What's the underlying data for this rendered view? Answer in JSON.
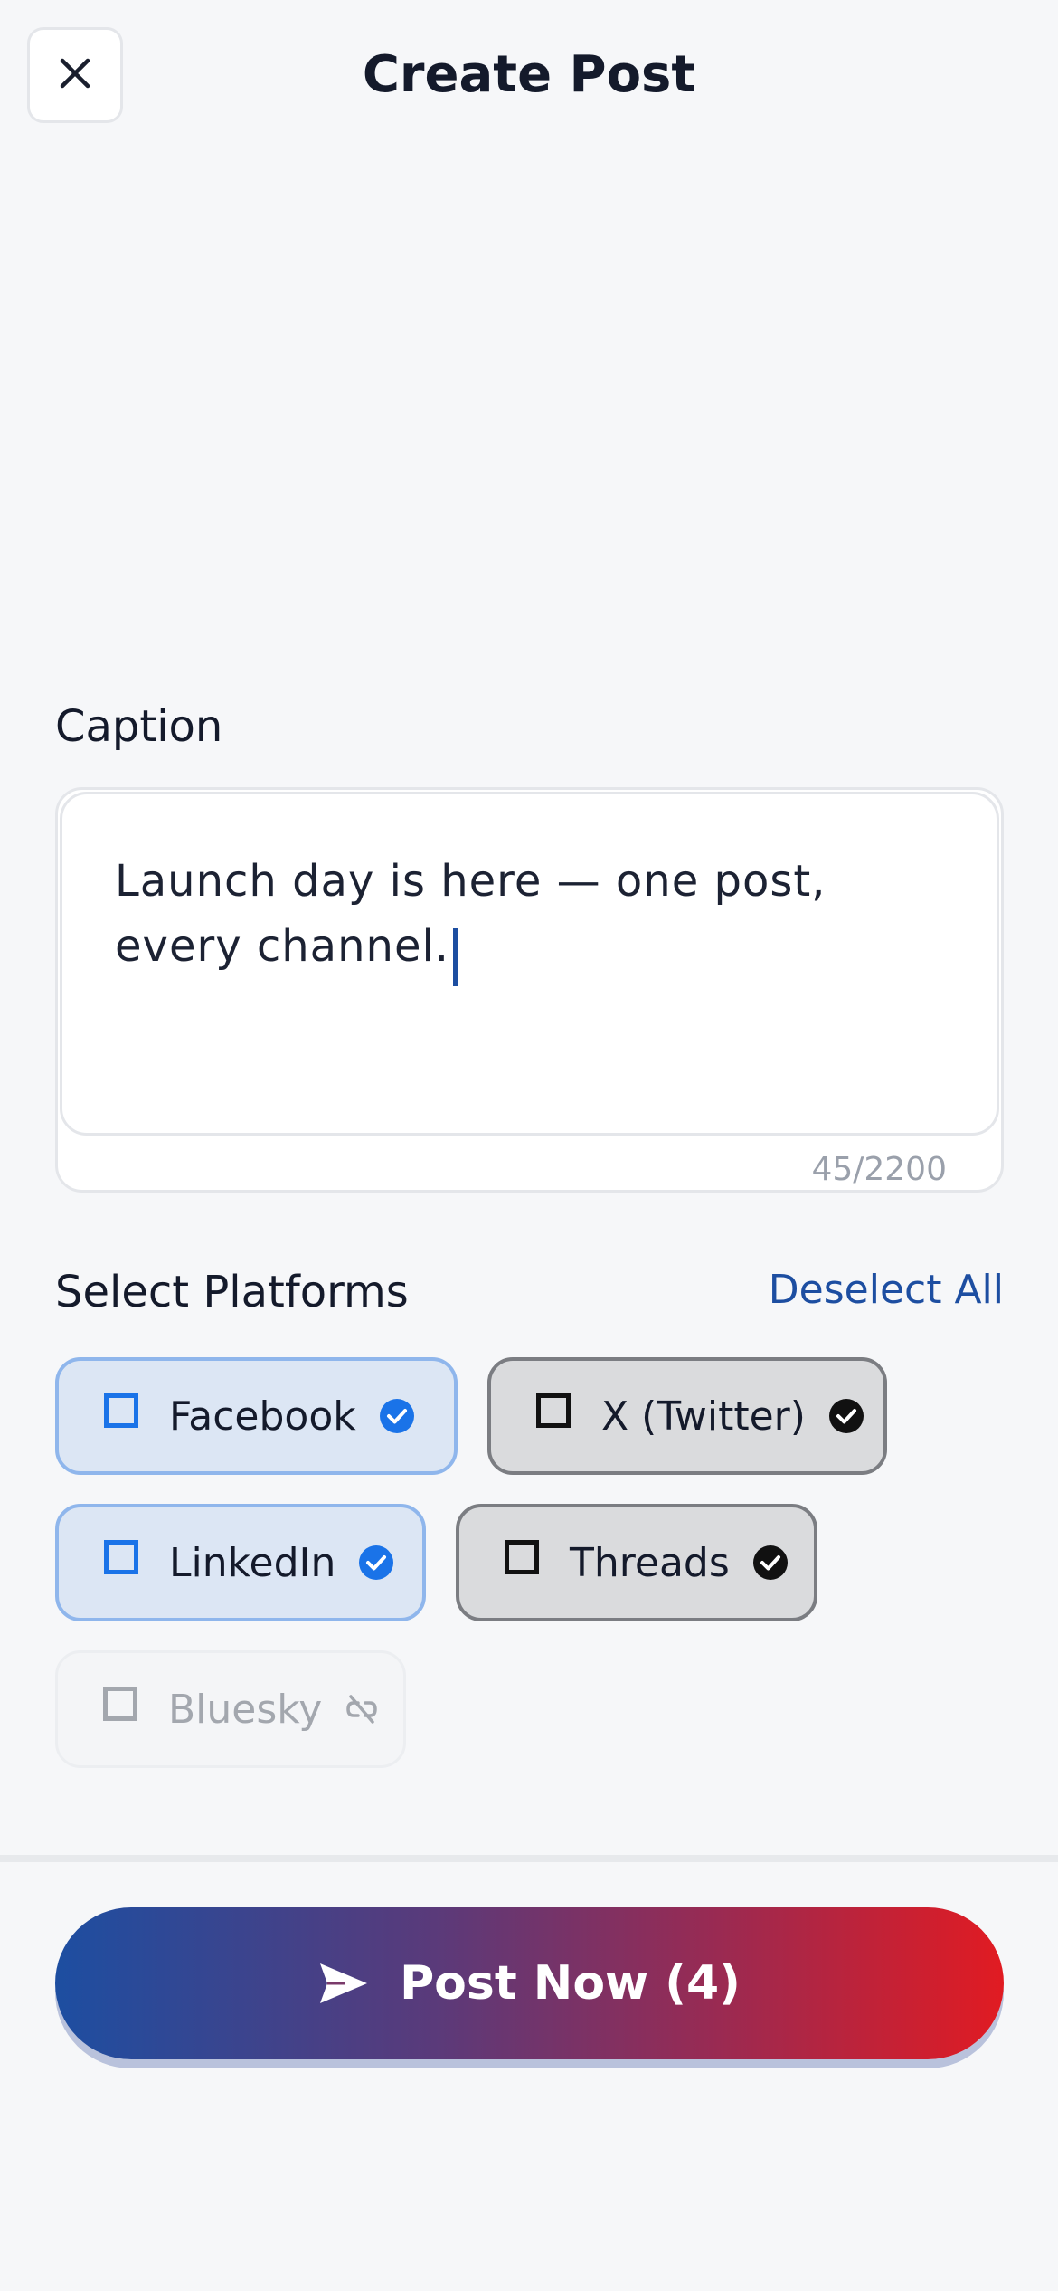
{
  "header": {
    "title": "Create Post",
    "close_icon": "close-icon"
  },
  "caption": {
    "label": "Caption",
    "text": "Launch day is here — one post, every channel.",
    "char_count": "45/2200"
  },
  "platforms": {
    "label": "Select Platforms",
    "deselect_label": "Deselect All",
    "items": [
      {
        "name": "Facebook",
        "state": "selected",
        "status_icon": "verified-check-icon"
      },
      {
        "name": "X (Twitter)",
        "state": "connected",
        "status_icon": "check-circle-icon"
      },
      {
        "name": "LinkedIn",
        "state": "selected",
        "status_icon": "verified-check-icon"
      },
      {
        "name": "Threads",
        "state": "connected",
        "status_icon": "check-circle-icon"
      },
      {
        "name": "Bluesky",
        "state": "disabled",
        "status_icon": "link-off-icon"
      }
    ]
  },
  "post_button": {
    "label": "Post Now (4)",
    "icon": "send-icon"
  },
  "colors": {
    "accent": "#1d4ea1",
    "gradient_start": "#1d4ea1",
    "gradient_end": "#e11b22",
    "checkbox_blue": "#1a73e8"
  }
}
